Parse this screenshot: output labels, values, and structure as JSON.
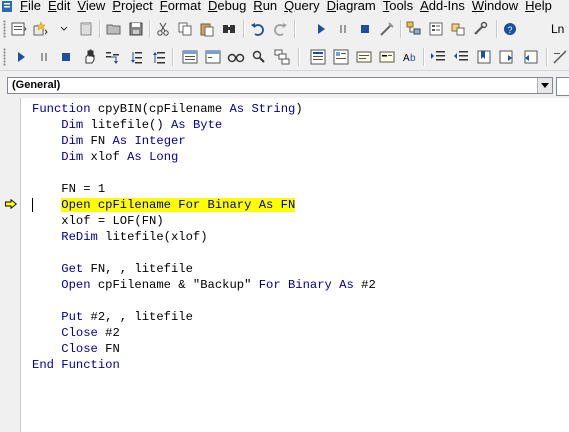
{
  "menu": [
    "File",
    "Edit",
    "View",
    "Project",
    "Format",
    "Debug",
    "Run",
    "Query",
    "Diagram",
    "Tools",
    "Add-Ins",
    "Window",
    "Help"
  ],
  "toolbar": {
    "line_label": "Ln"
  },
  "combo": {
    "procedure_value": "(General)"
  },
  "code": {
    "lines": [
      [
        {
          "t": "Function",
          "k": true
        },
        {
          "t": " cpyBIN(cpFilename ",
          "k": false
        },
        {
          "t": "As",
          "k": true
        },
        {
          "t": " ",
          "k": false
        },
        {
          "t": "String",
          "k": true
        },
        {
          "t": ")",
          "k": false
        }
      ],
      [
        {
          "t": "    Dim",
          "k": true
        },
        {
          "t": " litefile() ",
          "k": false
        },
        {
          "t": "As",
          "k": true
        },
        {
          "t": " ",
          "k": false
        },
        {
          "t": "Byte",
          "k": true
        }
      ],
      [
        {
          "t": "    Dim",
          "k": true
        },
        {
          "t": " FN ",
          "k": false
        },
        {
          "t": "As",
          "k": true
        },
        {
          "t": " ",
          "k": false
        },
        {
          "t": "Integer",
          "k": true
        }
      ],
      [
        {
          "t": "    Dim",
          "k": true
        },
        {
          "t": " xlof ",
          "k": false
        },
        {
          "t": "As",
          "k": true
        },
        {
          "t": " ",
          "k": false
        },
        {
          "t": "Long",
          "k": true
        }
      ],
      [],
      [
        {
          "t": "    FN = 1",
          "k": false
        }
      ],
      [
        {
          "t": "    ",
          "k": false
        },
        {
          "t": "Open cpFilename For Binary As FN",
          "k": true,
          "hl": true
        }
      ],
      [
        {
          "t": "    xlof = LOF(FN)",
          "k": false
        }
      ],
      [
        {
          "t": "    ReDim",
          "k": true
        },
        {
          "t": " litefile(xlof)",
          "k": false
        }
      ],
      [],
      [
        {
          "t": "    Get",
          "k": true
        },
        {
          "t": " FN, , litefile",
          "k": false
        }
      ],
      [
        {
          "t": "    Open",
          "k": true
        },
        {
          "t": " cpFilename & \"Backup\" ",
          "k": false
        },
        {
          "t": "For Binary As",
          "k": true
        },
        {
          "t": " #2",
          "k": false
        }
      ],
      [],
      [
        {
          "t": "    Put",
          "k": true
        },
        {
          "t": " #2, , litefile",
          "k": false
        }
      ],
      [
        {
          "t": "    Close",
          "k": true
        },
        {
          "t": " #2",
          "k": false
        }
      ],
      [
        {
          "t": "    Close",
          "k": true
        },
        {
          "t": " FN",
          "k": false
        }
      ],
      [
        {
          "t": "End Function",
          "k": true
        }
      ]
    ]
  },
  "colors": {
    "keyword": "#00008b",
    "highlight": "#ffff00",
    "exec_arrow": "#ffff00"
  }
}
